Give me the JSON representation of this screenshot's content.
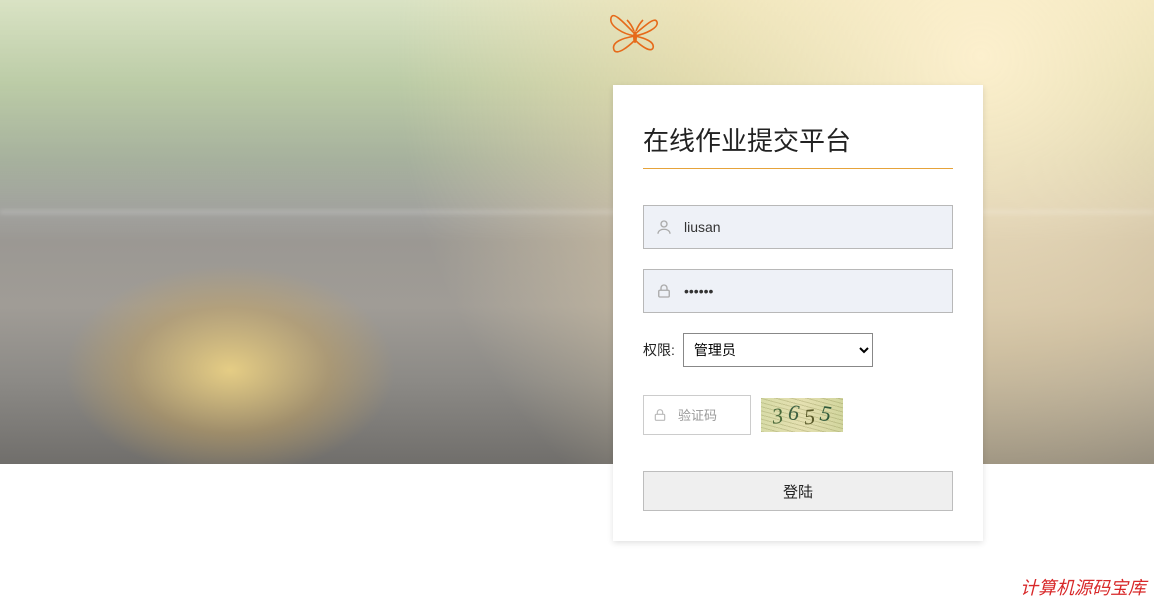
{
  "title": "在线作业提交平台",
  "username": {
    "value": "liusan",
    "placeholder": ""
  },
  "password": {
    "value": "••••••",
    "placeholder": ""
  },
  "permission": {
    "label": "权限:",
    "selected": "管理员"
  },
  "captcha": {
    "placeholder": "验证码",
    "code": "3655"
  },
  "login_button": "登陆",
  "footer": "计算机源码宝库"
}
